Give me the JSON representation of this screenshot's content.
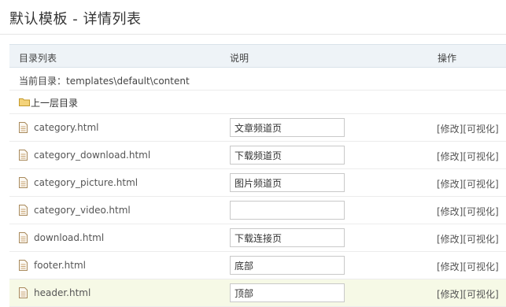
{
  "header": {
    "title": "默认模板 - 详情列表"
  },
  "table": {
    "columns": {
      "name": "目录列表",
      "desc": "说明",
      "op": "操作"
    },
    "current_dir": "当前目录：templates\\default\\content",
    "up_dir": "上一层目录",
    "rows": [
      {
        "name": "category.html",
        "desc": "文章频道页"
      },
      {
        "name": "category_download.html",
        "desc": "下载频道页"
      },
      {
        "name": "category_picture.html",
        "desc": "图片频道页"
      },
      {
        "name": "category_video.html",
        "desc": ""
      },
      {
        "name": "download.html",
        "desc": "下载连接页"
      },
      {
        "name": "footer.html",
        "desc": "底部"
      },
      {
        "name": "header.html",
        "desc": "顶部"
      }
    ],
    "op_edit": "[修改]",
    "op_visual": "[可视化]"
  },
  "icons": {
    "up_dir": "folder-icon",
    "file": "file-icon"
  }
}
